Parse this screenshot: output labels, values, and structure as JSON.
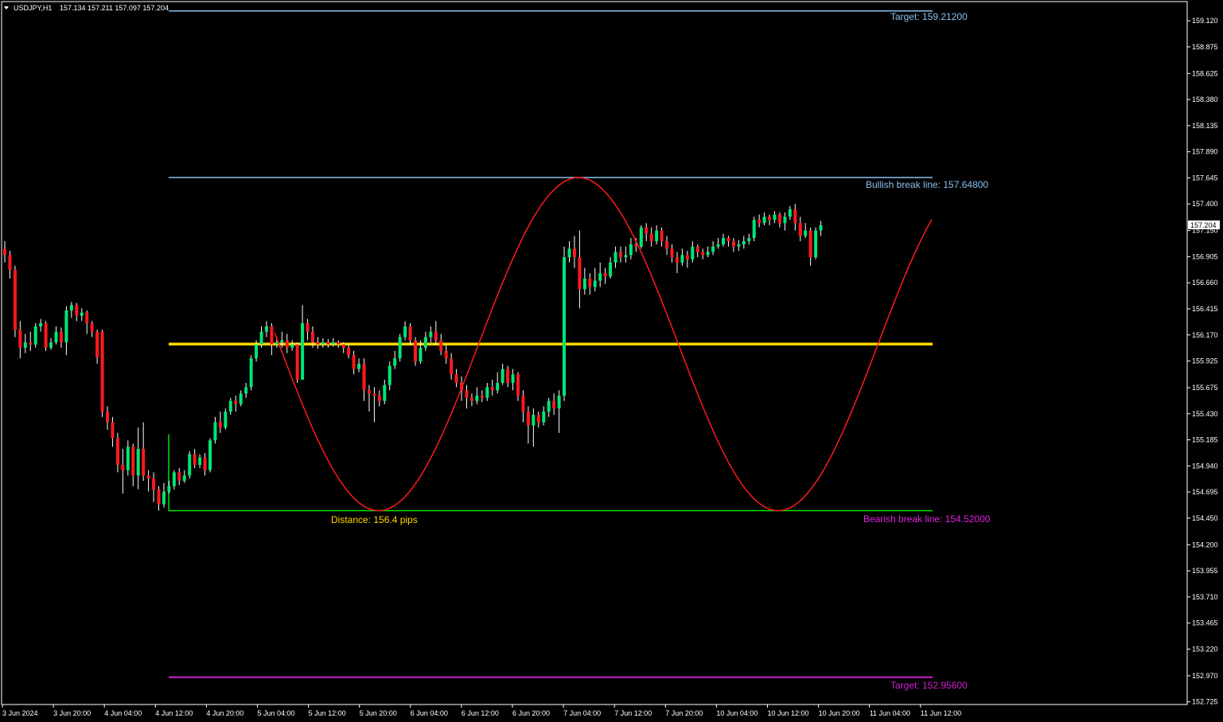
{
  "header": {
    "symbol": "USDJPY,H1",
    "ohlc": "157.134 157.211 157.097 157.204"
  },
  "colors": {
    "background": "#000000",
    "bull_candle": "#00e676",
    "bear_candle": "#ff1a1a",
    "wick": "#ffffff",
    "target_top": "#87c0f0",
    "bullish_line": "#87c0f0",
    "bearish_line": "#00e000",
    "bearish_label": "#e020e0",
    "target_bottom": "#d020d0",
    "mid_line": "#ffd700",
    "sine": "#ff1a1a",
    "distance_label": "#ffd700"
  },
  "annotations": {
    "target_top": "Target: 159.21200",
    "bullish_break": "Bullish break line: 157.64800",
    "bearish_break": "Bearish break line: 154.52000",
    "target_bottom": "Target: 152.95600",
    "distance": "Distance: 156.4 pips"
  },
  "current_price": "157.204",
  "chart_data": {
    "type": "candlestick",
    "title": "USDJPY,H1",
    "ylim": [
      152.7,
      159.3
    ],
    "y_ticks": [
      "159.120",
      "158.875",
      "158.625",
      "158.380",
      "158.135",
      "157.890",
      "157.645",
      "157.400",
      "157.150",
      "156.905",
      "156.660",
      "156.415",
      "156.170",
      "155.925",
      "155.675",
      "155.430",
      "155.185",
      "154.940",
      "154.695",
      "154.450",
      "154.200",
      "153.955",
      "153.710",
      "153.465",
      "153.220",
      "152.970",
      "152.725"
    ],
    "x_ticks": [
      "3 Jun 2024",
      "3 Jun 20:00",
      "4 Jun 04:00",
      "4 Jun 12:00",
      "4 Jun 20:00",
      "5 Jun 04:00",
      "5 Jun 12:00",
      "5 Jun 20:00",
      "6 Jun 04:00",
      "6 Jun 12:00",
      "6 Jun 20:00",
      "7 Jun 04:00",
      "7 Jun 12:00",
      "7 Jun 20:00",
      "10 Jun 04:00",
      "10 Jun 12:00",
      "10 Jun 20:00",
      "11 Jun 04:00",
      "11 Jun 12:00"
    ],
    "levels": {
      "target_top": 159.212,
      "bullish_break": 157.648,
      "mid": 156.084,
      "bearish_break": 154.52,
      "target_bottom": 152.956
    },
    "candles": [
      [
        156.98,
        156.92,
        157.05,
        156.85
      ],
      [
        156.92,
        156.78,
        156.96,
        156.7
      ],
      [
        156.78,
        156.22,
        156.82,
        156.15
      ],
      [
        156.22,
        156.05,
        156.3,
        155.95
      ],
      [
        156.05,
        156.1,
        156.18,
        156.0
      ],
      [
        156.1,
        156.08,
        156.2,
        156.02
      ],
      [
        156.08,
        156.25,
        156.28,
        156.05
      ],
      [
        156.25,
        156.28,
        156.32,
        156.2
      ],
      [
        156.28,
        156.05,
        156.3,
        156.02
      ],
      [
        156.05,
        156.1,
        156.14,
        156.03
      ],
      [
        156.1,
        156.2,
        156.25,
        156.08
      ],
      [
        156.2,
        156.1,
        156.24,
        156.05
      ],
      [
        156.1,
        156.4,
        156.44,
        155.98
      ],
      [
        156.4,
        156.45,
        156.48,
        156.33
      ],
      [
        156.45,
        156.35,
        156.47,
        156.3
      ],
      [
        156.35,
        156.38,
        156.42,
        156.3
      ],
      [
        156.38,
        156.28,
        156.4,
        156.18
      ],
      [
        156.28,
        156.2,
        156.3,
        156.15
      ],
      [
        156.2,
        155.96,
        156.22,
        155.9
      ],
      [
        156.2,
        155.45,
        156.22,
        155.4
      ],
      [
        155.45,
        155.35,
        155.5,
        155.28
      ],
      [
        155.35,
        155.2,
        155.4,
        155.12
      ],
      [
        155.2,
        154.95,
        155.25,
        154.88
      ],
      [
        154.95,
        154.9,
        155.1,
        154.68
      ],
      [
        154.9,
        155.12,
        155.18,
        154.85
      ],
      [
        155.12,
        154.85,
        155.15,
        154.75
      ],
      [
        154.85,
        155.1,
        155.3,
        154.72
      ],
      [
        155.1,
        154.85,
        155.35,
        154.8
      ],
      [
        154.85,
        154.82,
        154.9,
        154.7
      ],
      [
        154.82,
        154.72,
        154.88,
        154.6
      ],
      [
        154.72,
        154.58,
        154.75,
        154.52
      ],
      [
        154.58,
        154.7,
        154.78,
        154.55
      ],
      [
        154.7,
        154.75,
        154.8,
        154.68
      ],
      [
        154.75,
        154.88,
        154.9,
        154.72
      ],
      [
        154.88,
        154.8,
        154.92,
        154.76
      ],
      [
        154.8,
        154.85,
        154.9,
        154.78
      ],
      [
        154.85,
        155.05,
        155.08,
        154.82
      ],
      [
        155.05,
        154.95,
        155.1,
        154.92
      ],
      [
        154.95,
        155.02,
        155.05,
        154.92
      ],
      [
        155.02,
        154.9,
        155.06,
        154.85
      ],
      [
        154.9,
        155.18,
        155.2,
        154.88
      ],
      [
        155.18,
        155.35,
        155.4,
        155.15
      ],
      [
        155.35,
        155.3,
        155.45,
        155.25
      ],
      [
        155.3,
        155.45,
        155.48,
        155.28
      ],
      [
        155.45,
        155.55,
        155.58,
        155.42
      ],
      [
        155.55,
        155.52,
        155.6,
        155.45
      ],
      [
        155.52,
        155.62,
        155.65,
        155.5
      ],
      [
        155.62,
        155.68,
        155.72,
        155.58
      ],
      [
        155.68,
        155.95,
        155.98,
        155.65
      ],
      [
        155.95,
        156.08,
        156.12,
        155.92
      ],
      [
        156.08,
        156.2,
        156.25,
        156.05
      ],
      [
        156.2,
        156.25,
        156.3,
        156.15
      ],
      [
        156.25,
        156.08,
        156.28,
        155.98
      ],
      [
        156.08,
        156.1,
        156.15,
        156.05
      ],
      [
        156.1,
        156.12,
        156.2,
        156.05
      ],
      [
        156.12,
        156.05,
        156.18,
        156.0
      ],
      [
        156.05,
        156.08,
        156.12,
        156.02
      ],
      [
        156.08,
        155.75,
        156.1,
        155.72
      ],
      [
        155.75,
        156.28,
        156.45,
        155.75
      ],
      [
        156.28,
        156.2,
        156.32,
        156.12
      ],
      [
        156.2,
        156.1,
        156.25,
        156.05
      ],
      [
        156.1,
        156.08,
        156.15,
        156.04
      ],
      [
        156.08,
        156.1,
        156.14,
        156.05
      ],
      [
        156.1,
        156.08,
        156.13,
        156.05
      ],
      [
        156.08,
        156.1,
        156.14,
        156.06
      ],
      [
        156.1,
        156.08,
        156.12,
        156.05
      ],
      [
        156.08,
        156.05,
        156.1,
        156.0
      ],
      [
        156.05,
        155.98,
        156.08,
        155.95
      ],
      [
        155.98,
        155.85,
        156.02,
        155.8
      ],
      [
        155.85,
        155.9,
        155.95,
        155.82
      ],
      [
        155.9,
        155.65,
        155.95,
        155.55
      ],
      [
        155.65,
        155.62,
        155.7,
        155.45
      ],
      [
        155.62,
        155.6,
        155.68,
        155.35
      ],
      [
        155.6,
        155.55,
        155.65,
        155.5
      ],
      [
        155.55,
        155.7,
        155.75,
        155.52
      ],
      [
        155.7,
        155.88,
        155.92,
        155.65
      ],
      [
        155.88,
        155.95,
        156.02,
        155.85
      ],
      [
        155.95,
        156.15,
        156.18,
        155.92
      ],
      [
        156.15,
        156.25,
        156.3,
        156.12
      ],
      [
        156.25,
        156.12,
        156.28,
        156.08
      ],
      [
        156.12,
        155.92,
        156.15,
        155.88
      ],
      [
        155.92,
        156.05,
        156.12,
        155.9
      ],
      [
        156.05,
        156.15,
        156.2,
        156.02
      ],
      [
        156.15,
        156.2,
        156.25,
        156.1
      ],
      [
        156.2,
        156.12,
        156.3,
        156.08
      ],
      [
        156.12,
        156.02,
        156.18,
        155.98
      ],
      [
        156.02,
        155.95,
        156.08,
        155.9
      ],
      [
        155.95,
        155.8,
        156.0,
        155.75
      ],
      [
        155.8,
        155.72,
        155.85,
        155.68
      ],
      [
        155.72,
        155.65,
        155.78,
        155.55
      ],
      [
        155.65,
        155.58,
        155.7,
        155.48
      ],
      [
        155.58,
        155.55,
        155.62,
        155.5
      ],
      [
        155.55,
        155.6,
        155.68,
        155.52
      ],
      [
        155.6,
        155.58,
        155.65,
        155.54
      ],
      [
        155.58,
        155.68,
        155.72,
        155.55
      ],
      [
        155.68,
        155.65,
        155.75,
        155.6
      ],
      [
        155.65,
        155.72,
        155.82,
        155.62
      ],
      [
        155.72,
        155.85,
        155.9,
        155.7
      ],
      [
        155.85,
        155.72,
        155.88,
        155.68
      ],
      [
        155.72,
        155.8,
        155.85,
        155.65
      ],
      [
        155.8,
        155.6,
        155.82,
        155.55
      ],
      [
        155.6,
        155.45,
        155.65,
        155.35
      ],
      [
        155.45,
        155.32,
        155.5,
        155.15
      ],
      [
        155.32,
        155.42,
        155.48,
        155.12
      ],
      [
        155.42,
        155.35,
        155.45,
        155.3
      ],
      [
        155.35,
        155.45,
        155.5,
        155.32
      ],
      [
        155.45,
        155.55,
        155.58,
        155.4
      ],
      [
        155.55,
        155.48,
        155.62,
        155.42
      ],
      [
        155.48,
        155.6,
        155.65,
        155.25
      ],
      [
        155.6,
        156.9,
        157.0,
        155.55
      ],
      [
        156.9,
        156.98,
        157.05,
        156.85
      ],
      [
        156.98,
        156.9,
        157.1,
        156.8
      ],
      [
        156.9,
        156.6,
        157.15,
        156.42
      ],
      [
        156.6,
        156.7,
        156.8,
        156.55
      ],
      [
        156.7,
        156.62,
        156.75,
        156.55
      ],
      [
        156.62,
        156.68,
        156.8,
        156.58
      ],
      [
        156.68,
        156.75,
        156.85,
        156.62
      ],
      [
        156.75,
        156.72,
        156.8,
        156.65
      ],
      [
        156.72,
        156.85,
        156.9,
        156.7
      ],
      [
        156.85,
        156.95,
        157.0,
        156.8
      ],
      [
        156.95,
        156.9,
        157.0,
        156.85
      ],
      [
        156.9,
        156.92,
        157.0,
        156.85
      ],
      [
        156.92,
        157.02,
        157.08,
        156.88
      ],
      [
        157.02,
        157.0,
        157.08,
        156.95
      ],
      [
        157.0,
        157.18,
        157.2,
        156.98
      ],
      [
        157.18,
        157.12,
        157.22,
        157.05
      ],
      [
        157.12,
        157.05,
        157.18,
        157.0
      ],
      [
        157.05,
        157.15,
        157.2,
        157.02
      ],
      [
        157.15,
        157.05,
        157.18,
        157.0
      ],
      [
        157.05,
        156.98,
        157.1,
        156.92
      ],
      [
        156.98,
        156.9,
        157.02,
        156.85
      ],
      [
        156.9,
        156.85,
        156.95,
        156.75
      ],
      [
        156.85,
        156.92,
        156.98,
        156.82
      ],
      [
        156.92,
        156.88,
        156.96,
        156.8
      ],
      [
        156.88,
        157.0,
        157.05,
        156.85
      ],
      [
        157.0,
        156.95,
        157.02,
        156.9
      ],
      [
        156.95,
        156.92,
        156.98,
        156.88
      ],
      [
        156.92,
        156.95,
        157.0,
        156.9
      ],
      [
        156.95,
        157.0,
        157.05,
        156.92
      ],
      [
        157.0,
        157.02,
        157.08,
        156.98
      ],
      [
        157.02,
        157.08,
        157.12,
        157.0
      ],
      [
        157.08,
        157.05,
        157.1,
        157.0
      ],
      [
        157.05,
        157.0,
        157.08,
        156.95
      ],
      [
        157.0,
        157.02,
        157.06,
        156.96
      ],
      [
        157.02,
        157.05,
        157.1,
        156.98
      ],
      [
        157.05,
        157.08,
        157.12,
        157.02
      ],
      [
        157.08,
        157.25,
        157.28,
        157.05
      ],
      [
        157.25,
        157.22,
        157.3,
        157.18
      ],
      [
        157.22,
        157.28,
        157.32,
        157.2
      ],
      [
        157.28,
        157.25,
        157.3,
        157.2
      ],
      [
        157.25,
        157.3,
        157.33,
        157.22
      ],
      [
        157.3,
        157.22,
        157.32,
        157.18
      ],
      [
        157.22,
        157.28,
        157.32,
        157.15
      ],
      [
        157.28,
        157.35,
        157.38,
        157.25
      ],
      [
        157.35,
        157.22,
        157.4,
        157.15
      ],
      [
        157.22,
        157.1,
        157.28,
        157.05
      ],
      [
        157.1,
        157.15,
        157.22,
        157.08
      ],
      [
        157.15,
        156.9,
        157.18,
        156.82
      ],
      [
        156.9,
        157.15,
        157.18,
        156.88
      ],
      [
        157.15,
        157.2,
        157.24,
        157.1
      ]
    ]
  }
}
